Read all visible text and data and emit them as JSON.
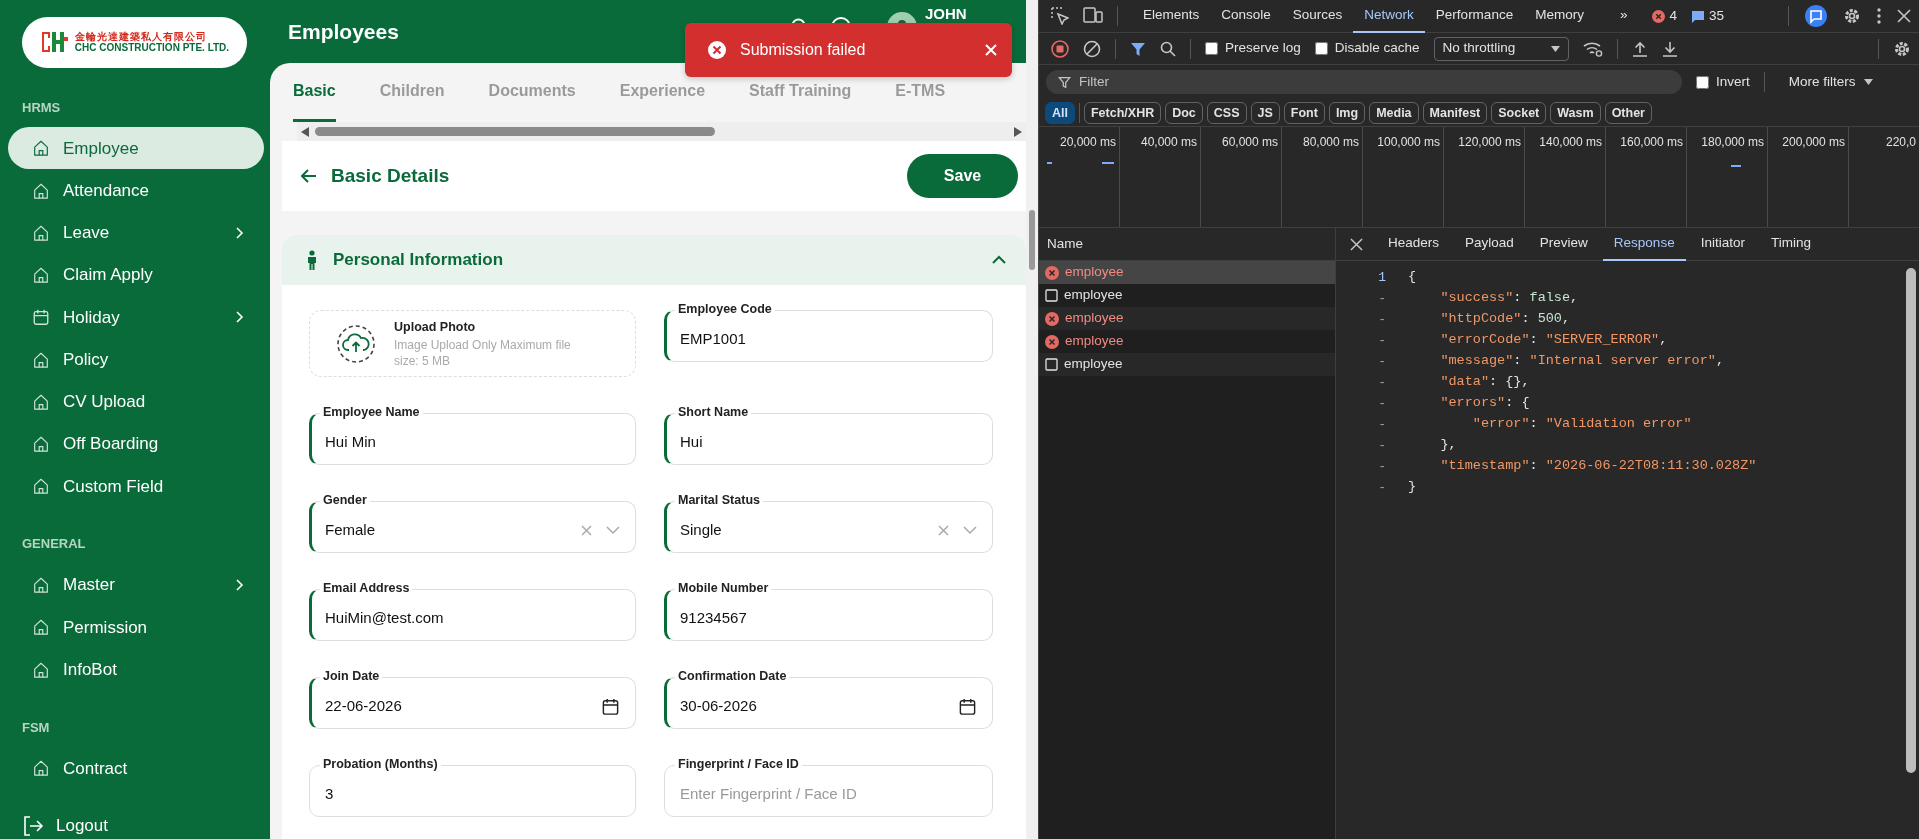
{
  "sidebar": {
    "logo": {
      "chinese_name": "金輪光達建築私人有限公司",
      "english_name": "CHC CONSTRUCTION PTE. LTD."
    },
    "sections": [
      {
        "title": "HRMS",
        "items": [
          {
            "label": "Employee",
            "selected": true,
            "has_submenu": false
          },
          {
            "label": "Attendance",
            "selected": false,
            "has_submenu": false
          },
          {
            "label": "Leave",
            "selected": false,
            "has_submenu": true
          },
          {
            "label": "Claim Apply",
            "selected": false,
            "has_submenu": false
          },
          {
            "label": "Holiday",
            "selected": false,
            "has_submenu": true
          },
          {
            "label": "Policy",
            "selected": false,
            "has_submenu": false
          },
          {
            "label": "CV Upload",
            "selected": false,
            "has_submenu": false
          },
          {
            "label": "Off Boarding",
            "selected": false,
            "has_submenu": false
          },
          {
            "label": "Custom Field",
            "selected": false,
            "has_submenu": false
          }
        ]
      },
      {
        "title": "GENERAL",
        "items": [
          {
            "label": "Master",
            "selected": false,
            "has_submenu": true
          },
          {
            "label": "Permission",
            "selected": false,
            "has_submenu": false
          },
          {
            "label": "InfoBot",
            "selected": false,
            "has_submenu": false
          }
        ]
      },
      {
        "title": "FSM",
        "items": [
          {
            "label": "Contract",
            "selected": false,
            "has_submenu": false
          }
        ]
      }
    ],
    "logout": "Logout"
  },
  "header": {
    "title": "Employees",
    "user_name": "JOHN"
  },
  "toast": {
    "kind": "error",
    "message": "Submission failed"
  },
  "tabs": [
    {
      "label": "Basic",
      "selected": true
    },
    {
      "label": "Children",
      "selected": false
    },
    {
      "label": "Documents",
      "selected": false
    },
    {
      "label": "Experience",
      "selected": false
    },
    {
      "label": "Staff Training",
      "selected": false
    },
    {
      "label": "E-TMS",
      "selected": false
    }
  ],
  "page": {
    "title": "Basic Details",
    "save_button": "Save"
  },
  "section": {
    "title": "Personal Information",
    "expanded": true
  },
  "upload": {
    "title": "Upload Photo",
    "hint": "Image Upload Only Maximum file size: 5 MB"
  },
  "fields": [
    {
      "label": "Employee Code",
      "kind": "text",
      "value": "EMP1001",
      "required": true
    },
    {
      "label": "Employee Name",
      "kind": "text",
      "value": "Hui Min",
      "required": true
    },
    {
      "label": "Short Name",
      "kind": "text",
      "value": "Hui",
      "required": true
    },
    {
      "label": "Gender",
      "kind": "select",
      "value": "Female",
      "required": true
    },
    {
      "label": "Marital Status",
      "kind": "select",
      "value": "Single",
      "required": true
    },
    {
      "label": "Email Address",
      "kind": "text",
      "value": "HuiMin@test.com",
      "required": true
    },
    {
      "label": "Mobile Number",
      "kind": "text",
      "value": "91234567",
      "required": true
    },
    {
      "label": "Join Date",
      "kind": "date",
      "value": "22-06-2026",
      "required": true
    },
    {
      "label": "Confirmation Date",
      "kind": "date",
      "value": "30-06-2026",
      "required": true
    },
    {
      "label": "Probation (Months)",
      "kind": "text",
      "value": "3",
      "required": false
    },
    {
      "label": "Fingerprint / Face ID",
      "kind": "text",
      "placeholder": "Enter Fingerprint / Face ID",
      "required": false
    }
  ],
  "devtools": {
    "tabs": [
      {
        "label": "Elements",
        "selected": false
      },
      {
        "label": "Console",
        "selected": false
      },
      {
        "label": "Sources",
        "selected": false
      },
      {
        "label": "Network",
        "selected": true
      },
      {
        "label": "Performance",
        "selected": false
      },
      {
        "label": "Memory",
        "selected": false
      }
    ],
    "overflow": "»",
    "error_count": "4",
    "message_count": "35",
    "preserve_log": {
      "label": "Preserve log",
      "checked": false
    },
    "disable_cache": {
      "label": "Disable cache",
      "checked": false
    },
    "throttling": "No throttling",
    "filter_placeholder": "Filter",
    "invert": {
      "label": "Invert",
      "checked": false
    },
    "more_filters": "More filters",
    "type_filters": [
      {
        "label": "All",
        "selected": true
      },
      {
        "label": "Fetch/XHR",
        "selected": false
      },
      {
        "label": "Doc",
        "selected": false
      },
      {
        "label": "CSS",
        "selected": false
      },
      {
        "label": "JS",
        "selected": false
      },
      {
        "label": "Font",
        "selected": false
      },
      {
        "label": "Img",
        "selected": false
      },
      {
        "label": "Media",
        "selected": false
      },
      {
        "label": "Manifest",
        "selected": false
      },
      {
        "label": "Socket",
        "selected": false
      },
      {
        "label": "Wasm",
        "selected": false
      },
      {
        "label": "Other",
        "selected": false
      }
    ],
    "timeline_ticks": [
      "20,000 ms",
      "40,000 ms",
      "60,000 ms",
      "80,000 ms",
      "100,000 ms",
      "120,000 ms",
      "140,000 ms",
      "160,000 ms",
      "180,000 ms",
      "200,000 ms",
      "220,0"
    ],
    "requests_header": "Name",
    "requests": [
      {
        "name": "employee",
        "failed": true,
        "selected": true
      },
      {
        "name": "employee",
        "failed": false,
        "selected": false
      },
      {
        "name": "employee",
        "failed": true,
        "selected": false
      },
      {
        "name": "employee",
        "failed": true,
        "selected": false
      },
      {
        "name": "employee",
        "failed": false,
        "selected": false
      }
    ],
    "detail_tabs": [
      {
        "label": "Headers",
        "selected": false
      },
      {
        "label": "Payload",
        "selected": false
      },
      {
        "label": "Preview",
        "selected": false
      },
      {
        "label": "Response",
        "selected": true
      },
      {
        "label": "Initiator",
        "selected": false
      },
      {
        "label": "Timing",
        "selected": false
      }
    ],
    "response_lines": [
      {
        "gutter": "1",
        "code": "{"
      },
      {
        "gutter": "-",
        "code": "    \"success\": false,"
      },
      {
        "gutter": "-",
        "code": "    \"httpCode\": 500,"
      },
      {
        "gutter": "-",
        "code": "    \"errorCode\": \"SERVER_ERROR\","
      },
      {
        "gutter": "-",
        "code": "    \"message\": \"Internal server error\","
      },
      {
        "gutter": "-",
        "code": "    \"data\": {},"
      },
      {
        "gutter": "-",
        "code": "    \"errors\": {"
      },
      {
        "gutter": "-",
        "code": "        \"error\": \"Validation error\""
      },
      {
        "gutter": "-",
        "code": "    },"
      },
      {
        "gutter": "-",
        "code": "    \"timestamp\": \"2026-06-22T08:11:30.028Z\""
      },
      {
        "gutter": "-",
        "code": "}"
      }
    ]
  }
}
